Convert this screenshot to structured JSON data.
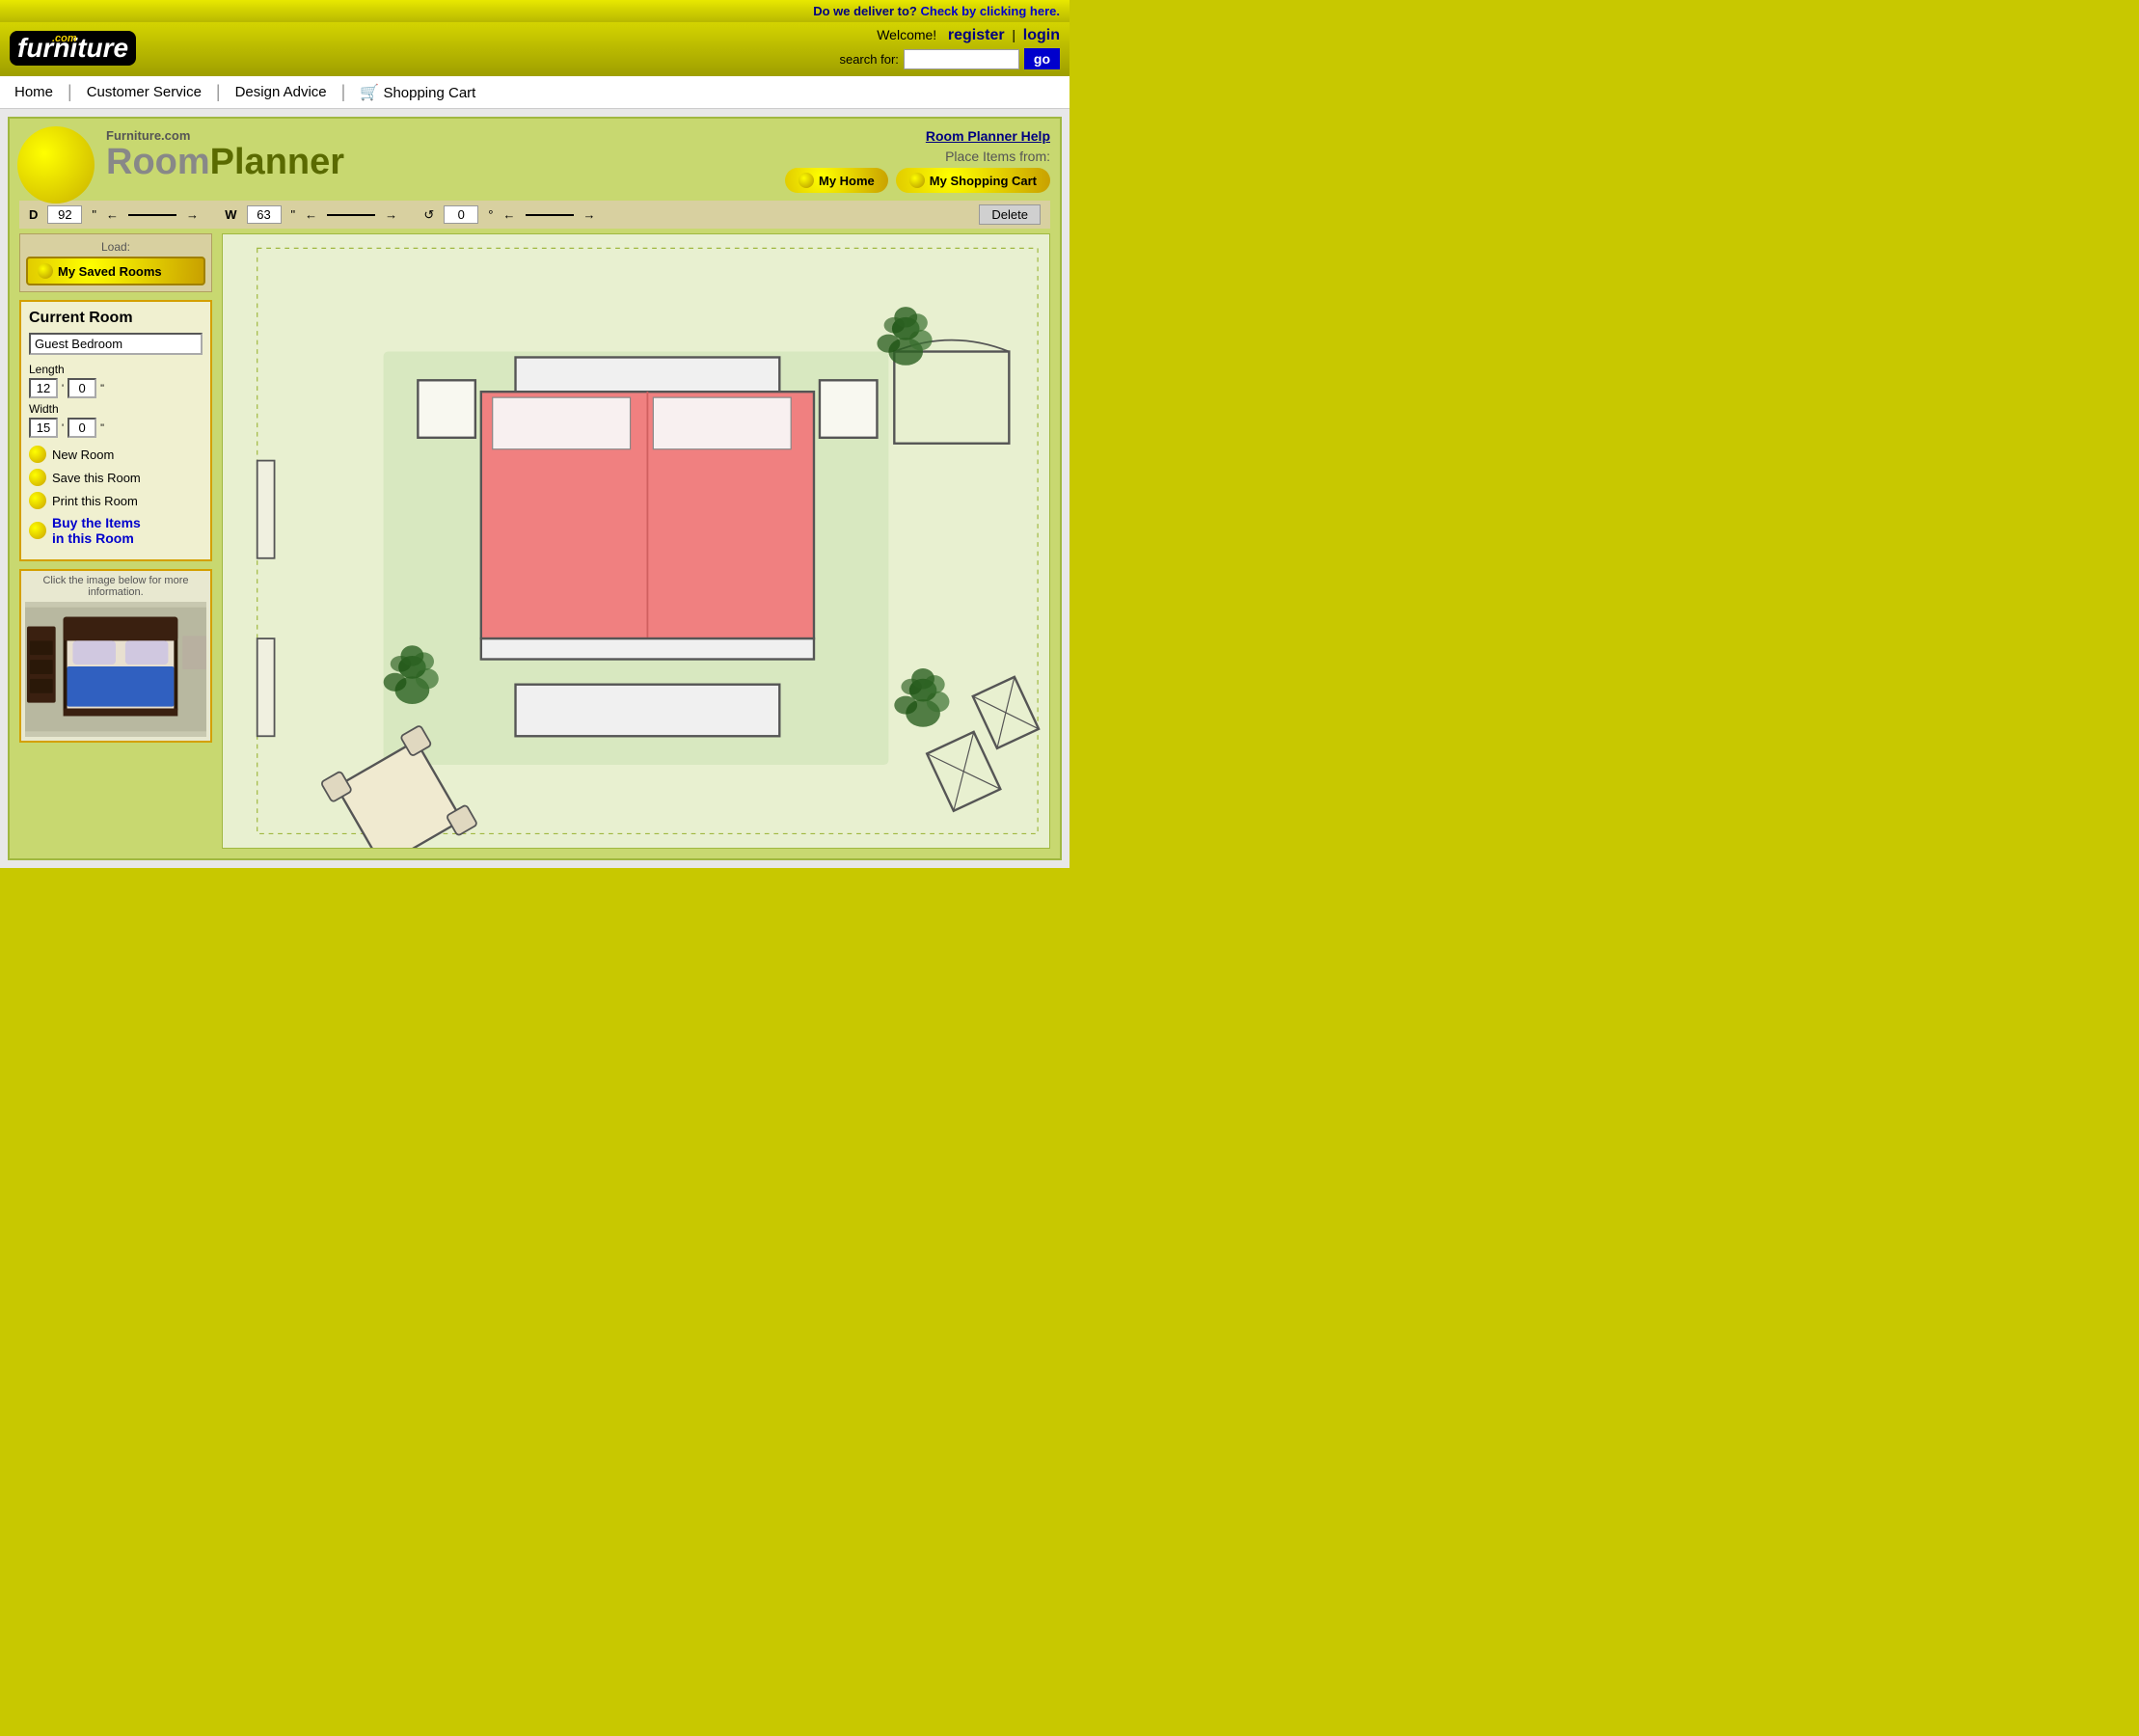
{
  "top_bar": {
    "deliver_text": "Do we deliver to?",
    "check_link": "Check by clicking here."
  },
  "header": {
    "logo_dot_com": ".com",
    "logo_furniture": "furniture",
    "welcome_text": "Welcome!",
    "register_label": "register",
    "pipe": "|",
    "login_label": "login",
    "search_label": "search for:",
    "search_placeholder": "",
    "go_label": "go"
  },
  "nav": {
    "items": [
      {
        "label": "Home",
        "id": "home"
      },
      {
        "label": "Customer Service",
        "id": "customer-service"
      },
      {
        "label": "Design Advice",
        "id": "design-advice"
      },
      {
        "label": "Shopping Cart",
        "id": "shopping-cart"
      }
    ]
  },
  "planner": {
    "logo_com": "Furniture.com",
    "logo_title": "Room Planner",
    "help_link": "Room Planner Help",
    "place_items_label": "Place Items from:",
    "my_home_label": "My Home",
    "my_cart_label": "My Shopping Cart",
    "dimension": {
      "d_label": "D",
      "d_value": "92",
      "d_unit": "\"",
      "w_label": "W",
      "w_value": "63",
      "w_unit": "\"",
      "rot_value": "0",
      "rot_unit": "°",
      "delete_label": "Delete"
    },
    "left": {
      "load_label": "Load:",
      "load_btn": "My Saved Rooms",
      "current_room_title": "Current Room",
      "room_name": "Guest Bedroom",
      "length_label": "Length",
      "length_ft": "12",
      "length_in": "0",
      "width_label": "Width",
      "width_ft": "15",
      "width_in": "0",
      "actions": [
        {
          "id": "new-room",
          "label": "New Room",
          "style": "normal"
        },
        {
          "id": "save-room",
          "label": "Save this Room",
          "style": "normal"
        },
        {
          "id": "print-room",
          "label": "Print this Room",
          "style": "normal"
        },
        {
          "id": "buy-items",
          "label": "Buy the Items\nin this Room",
          "style": "buy"
        }
      ],
      "preview_hint": "Click the image below for more information.",
      "preview_alt": "Bed furniture preview"
    }
  }
}
